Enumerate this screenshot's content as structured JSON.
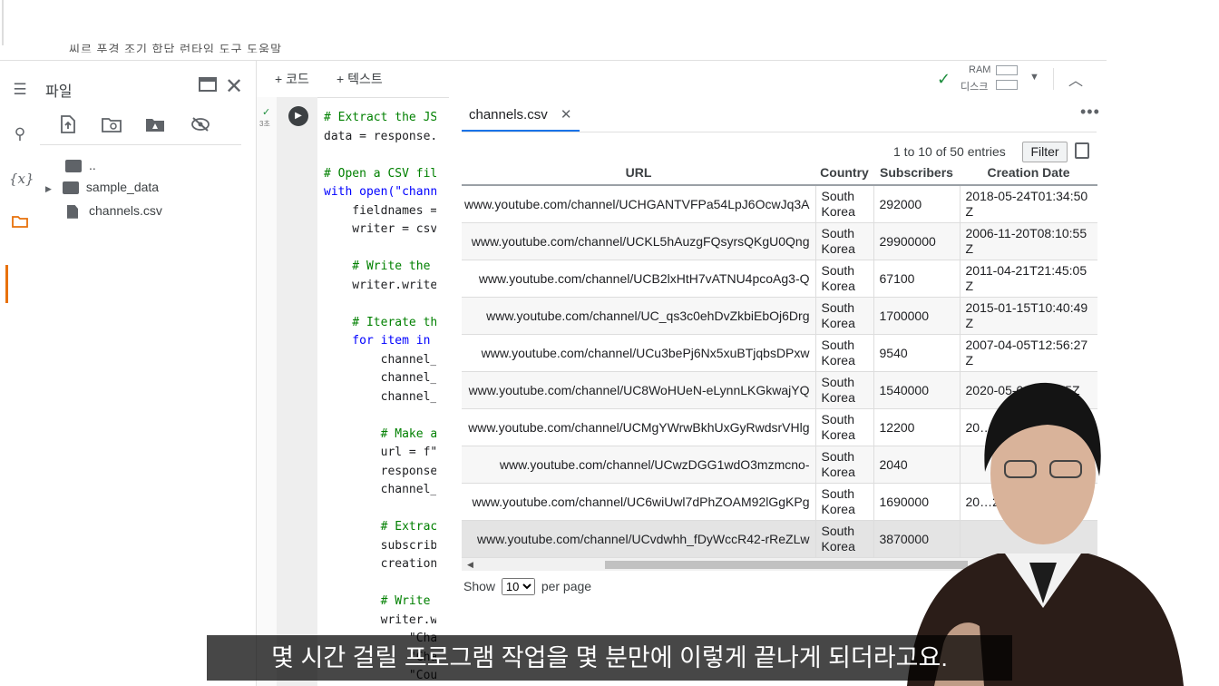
{
  "menu": {
    "row_text": "씨르 푸경 조기 합답 런타임 도구 도움말"
  },
  "rail": {
    "icons": [
      "toc-icon",
      "search-icon",
      "variables-icon",
      "folder-icon"
    ],
    "variables_glyph": "{x}"
  },
  "files_panel": {
    "title": "파일",
    "tree": [
      {
        "label": "..",
        "type": "parent-folder"
      },
      {
        "label": "sample_data",
        "type": "folder"
      },
      {
        "label": "channels.csv",
        "type": "file"
      }
    ]
  },
  "notebook_toolbar": {
    "add_code": "+ 코드",
    "add_text": "+ 텍스트",
    "ram_label": "RAM",
    "disk_label": "디스크"
  },
  "cell": {
    "status": "3초",
    "code_lines": [
      {
        "text": "# Extract the JSON",
        "kind": "comment"
      },
      {
        "text": "data = response.json()",
        "kind": "code"
      },
      {
        "text": "",
        "kind": "code"
      },
      {
        "text": "# Open a CSV file",
        "kind": "comment"
      },
      {
        "text": "with open(\"channels.csv\"",
        "kind": "keyword"
      },
      {
        "text": "    fieldnames = ",
        "kind": "code"
      },
      {
        "text": "    writer = csv.",
        "kind": "code"
      },
      {
        "text": "",
        "kind": "code"
      },
      {
        "text": "    # Write the h",
        "kind": "comment"
      },
      {
        "text": "    writer.writeh",
        "kind": "code"
      },
      {
        "text": "",
        "kind": "code"
      },
      {
        "text": "    # Iterate thr",
        "kind": "comment"
      },
      {
        "text": "    for item in d",
        "kind": "keyword"
      },
      {
        "text": "        channel_i",
        "kind": "code"
      },
      {
        "text": "        channel_u",
        "kind": "code"
      },
      {
        "text": "        channel_n",
        "kind": "code"
      },
      {
        "text": "",
        "kind": "code"
      },
      {
        "text": "        # Make a ",
        "kind": "comment"
      },
      {
        "text": "        url = f\"h",
        "kind": "code"
      },
      {
        "text": "        response ",
        "kind": "code"
      },
      {
        "text": "        channel_d",
        "kind": "code"
      },
      {
        "text": "",
        "kind": "code"
      },
      {
        "text": "        # Extract",
        "kind": "comment"
      },
      {
        "text": "        subscribe",
        "kind": "code"
      },
      {
        "text": "        creation_",
        "kind": "code"
      },
      {
        "text": "",
        "kind": "code"
      },
      {
        "text": "        # Write t",
        "kind": "comment"
      },
      {
        "text": "        writer.wr",
        "kind": "code"
      },
      {
        "text": "            \"Char",
        "kind": "code"
      },
      {
        "text": "            \"Char",
        "kind": "code"
      },
      {
        "text": "            \"Cour",
        "kind": "code"
      }
    ]
  },
  "csv_viewer": {
    "tab_label": "channels.csv",
    "entries_text": "1 to 10 of 50 entries",
    "filter_label": "Filter",
    "columns": [
      "URL",
      "Country",
      "Subscribers",
      "Creation Date"
    ],
    "rows": [
      {
        "url": "www.youtube.com/channel/UCHGANTVFPa54LpJ6OcwJq3A",
        "country": "South Korea",
        "subscribers": "292000",
        "created": "2018-05-24T01:34:50Z"
      },
      {
        "url": "www.youtube.com/channel/UCKL5hAuzgFQsyrsQKgU0Qng",
        "country": "South Korea",
        "subscribers": "29900000",
        "created": "2006-11-20T08:10:55Z"
      },
      {
        "url": "www.youtube.com/channel/UCB2lxHtH7vATNU4pcoAg3-Q",
        "country": "South Korea",
        "subscribers": "67100",
        "created": "2011-04-21T21:45:05Z"
      },
      {
        "url": "www.youtube.com/channel/UC_qs3c0ehDvZkbiEbOj6Drg",
        "country": "South Korea",
        "subscribers": "1700000",
        "created": "2015-01-15T10:40:49Z"
      },
      {
        "url": "www.youtube.com/channel/UCu3bePj6Nx5xuBTjqbsDPxw",
        "country": "South Korea",
        "subscribers": "9540",
        "created": "2007-04-05T12:56:27Z"
      },
      {
        "url": "www.youtube.com/channel/UC8WoHUeN-eLynnLKGkwajYQ",
        "country": "South Korea",
        "subscribers": "1540000",
        "created": "2020-05-08T0…75Z"
      },
      {
        "url": "www.youtube.com/channel/UCMgYWrwBkhUxGyRwdsrVHlg",
        "country": "South Korea",
        "subscribers": "12200",
        "created": "20…"
      },
      {
        "url": "www.youtube.com/channel/UCwzDGG1wdO3mzmcno-",
        "country": "South Korea",
        "subscribers": "2040",
        "created": ""
      },
      {
        "url": "www.youtube.com/channel/UC6wiUwl7dPhZOAM92lGgKPg",
        "country": "South Korea",
        "subscribers": "1690000",
        "created": "20…26T"
      },
      {
        "url": "www.youtube.com/channel/UCvdwhh_fDyWccR42-rReZLw",
        "country": "South Korea",
        "subscribers": "3870000",
        "created": ""
      }
    ],
    "pager": {
      "show_label": "Show",
      "page_size": "10",
      "per_page_label": "per page"
    }
  },
  "subtitle": "몇 시간 걸릴 프로그램 작업을 몇 분만에 이렇게 끝나게 되더라고요.",
  "colors": {
    "accent_blue": "#1a73e8",
    "active_orange": "#e8710a",
    "check_green": "#1e8e3e"
  }
}
